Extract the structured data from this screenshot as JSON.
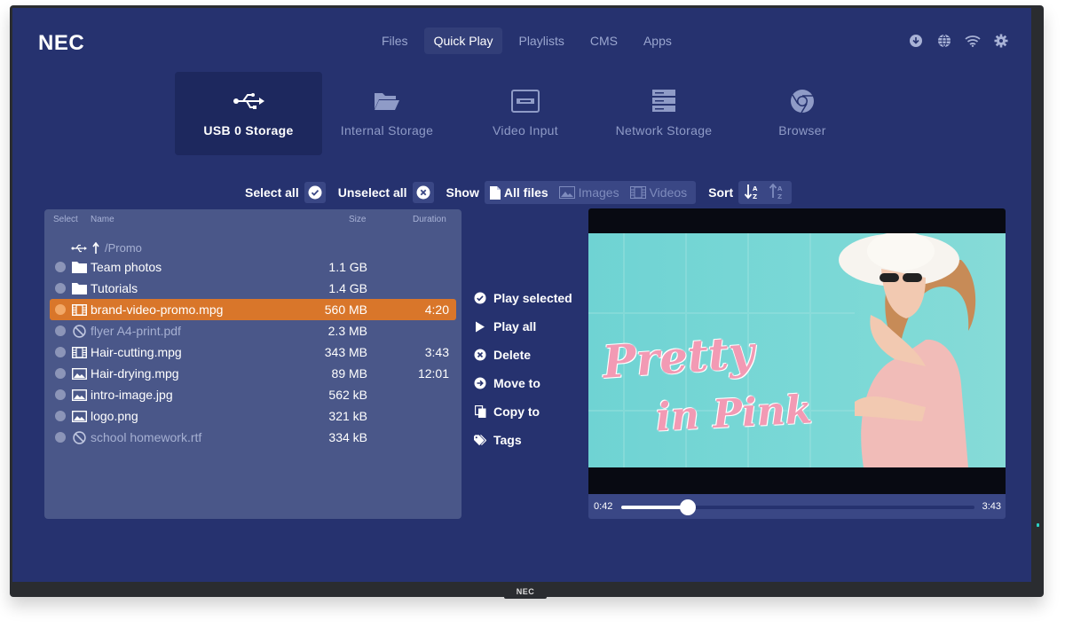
{
  "colors": {
    "screen_bg": "#26326f",
    "panel_bg": "#4a5789",
    "accent_orange": "#d9762a",
    "video_bg": "#7ad8d6",
    "title_pink": "#f29ab4"
  },
  "brand": {
    "logo": "NEC",
    "bezel_logo": "NEC"
  },
  "nav": {
    "tabs": [
      {
        "label": "Files"
      },
      {
        "label": "Quick Play",
        "active": true
      },
      {
        "label": "Playlists"
      },
      {
        "label": "CMS"
      },
      {
        "label": "Apps"
      }
    ]
  },
  "top_icons": [
    "download-icon",
    "globe-icon",
    "wifi-icon",
    "gear-icon"
  ],
  "sources": [
    {
      "label": "USB 0 Storage",
      "icon": "usb-icon",
      "active": true
    },
    {
      "label": "Internal Storage",
      "icon": "folder-open-icon"
    },
    {
      "label": "Video Input",
      "icon": "video-input-icon"
    },
    {
      "label": "Network Storage",
      "icon": "server-icon"
    },
    {
      "label": "Browser",
      "icon": "chrome-icon"
    }
  ],
  "filter": {
    "select_all": "Select all",
    "unselect_all": "Unselect all",
    "show": "Show",
    "all_files": "All files",
    "images": "Images",
    "videos": "Videos",
    "sort": "Sort"
  },
  "files": {
    "headers": {
      "select": "Select",
      "name": "Name",
      "size": "Size",
      "duration": "Duration"
    },
    "path": "/Promo",
    "rows": [
      {
        "type": "folder",
        "name": "Team photos",
        "size": "1.1 GB",
        "duration": ""
      },
      {
        "type": "folder",
        "name": "Tutorials",
        "size": "1.4 GB",
        "duration": ""
      },
      {
        "type": "video",
        "name": "brand-video-promo.mpg",
        "size": "560 MB",
        "duration": "4:20",
        "selected": true
      },
      {
        "type": "unsupported",
        "name": "flyer A4-print.pdf",
        "size": "2.3 MB",
        "duration": ""
      },
      {
        "type": "video",
        "name": "Hair-cutting.mpg",
        "size": "343 MB",
        "duration": "3:43"
      },
      {
        "type": "image",
        "name": "Hair-drying.mpg",
        "size": "89 MB",
        "duration": "12:01"
      },
      {
        "type": "image",
        "name": "intro-image.jpg",
        "size": "562 kB",
        "duration": ""
      },
      {
        "type": "image",
        "name": "logo.png",
        "size": "321 kB",
        "duration": ""
      },
      {
        "type": "unsupported",
        "name": "school homework.rtf",
        "size": "334 kB",
        "duration": ""
      }
    ]
  },
  "actions": [
    {
      "label": "Play selected",
      "icon": "check-circle-icon"
    },
    {
      "label": "Play all",
      "icon": "play-icon"
    },
    {
      "label": "Delete",
      "icon": "delete-circle-icon"
    },
    {
      "label": "Move to",
      "icon": "arrow-right-circle-icon"
    },
    {
      "label": "Copy to",
      "icon": "copy-icon"
    },
    {
      "label": "Tags",
      "icon": "tag-icon"
    }
  ],
  "player": {
    "title_line1": "Pretty",
    "title_line2": "in Pink",
    "current_time": "0:42",
    "total_time": "3:43",
    "progress": 0.188
  }
}
